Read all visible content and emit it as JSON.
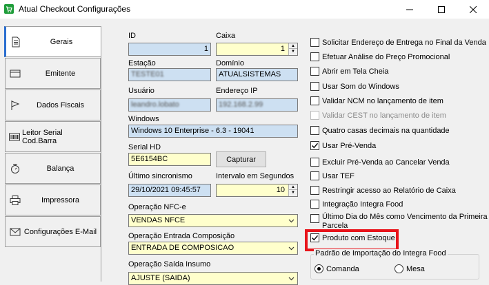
{
  "window": {
    "title": "Atual Checkout Configurações"
  },
  "tabs": [
    {
      "label": "Gerais",
      "icon": "document-icon"
    },
    {
      "label": "Emitente",
      "icon": "card-icon"
    },
    {
      "label": "Dados Fiscais",
      "icon": "flag-icon"
    },
    {
      "label": "Leitor Serial Cod.Barra",
      "icon": "barcode-icon"
    },
    {
      "label": "Balança",
      "icon": "scale-icon"
    },
    {
      "label": "Impressora",
      "icon": "printer-icon"
    },
    {
      "label": "Configurações E-Mail",
      "icon": "email-icon"
    }
  ],
  "form": {
    "id_label": "ID",
    "id_value": "1",
    "caixa_label": "Caixa",
    "caixa_value": "1",
    "estacao_label": "Estação",
    "estacao_value": "TESTE01",
    "dominio_label": "Domínio",
    "dominio_value": "ATUALSISTEMAS",
    "usuario_label": "Usuário",
    "usuario_value": "leandro.lobato",
    "endereco_ip_label": "Endereço IP",
    "endereco_ip_value": "192.168.2.99",
    "windows_label": "Windows",
    "windows_value": "Windows 10 Enterprise - 6.3 - 19041",
    "serial_hd_label": "Serial HD",
    "serial_hd_value": "5E6154BC",
    "capturar_label": "Capturar",
    "ultimo_sinc_label": "Último sincronismo",
    "ultimo_sinc_value": "29/10/2021 09:45:57",
    "intervalo_label": "Intervalo em Segundos",
    "intervalo_value": "10",
    "op_nfce_label": "Operação NFC-e",
    "op_nfce_value": "VENDAS NFCE",
    "op_entrada_label": "Operação Entrada Composição",
    "op_entrada_value": "ENTRADA DE COMPOSICAO",
    "op_saida_label": "Operação Saída Insumo",
    "op_saida_value": "AJUSTE (SAIDA)"
  },
  "options": [
    {
      "label": "Solicitar Endereço de Entrega no Final da Venda",
      "checked": false,
      "enabled": true
    },
    {
      "label": "Efetuar Análise do Preço Promocional",
      "checked": false,
      "enabled": true
    },
    {
      "label": "Abrir em Tela Cheia",
      "checked": false,
      "enabled": true
    },
    {
      "label": "Usar Som do Windows",
      "checked": false,
      "enabled": true
    },
    {
      "label": "Validar NCM no lançamento de item",
      "checked": false,
      "enabled": true
    },
    {
      "label": "Validar CEST no lançamento de item",
      "checked": false,
      "enabled": false
    },
    {
      "label": "Quatro casas decimais na quantidade",
      "checked": false,
      "enabled": true
    },
    {
      "label": "Usar Pré-Venda",
      "checked": true,
      "enabled": true
    },
    {
      "label": "Excluir Pré-Venda ao Cancelar Venda",
      "checked": false,
      "enabled": true
    },
    {
      "label": "Usar TEF",
      "checked": false,
      "enabled": true
    },
    {
      "label": "Restringir acesso ao Relatório de Caixa",
      "checked": false,
      "enabled": true
    },
    {
      "label": "Integração Integra Food",
      "checked": false,
      "enabled": true
    },
    {
      "label": "Último Dia do Mês como Vencimento da Primeira Parcela",
      "checked": false,
      "enabled": true
    },
    {
      "label": "Produto com Estoque",
      "checked": true,
      "enabled": true
    }
  ],
  "integra_food": {
    "title": "Padrão de Importação do Integra Food",
    "option_comanda": "Comanda",
    "option_mesa": "Mesa",
    "selected": "Comanda"
  },
  "colors": {
    "field_blue": "#cde0f2",
    "field_yellow": "#ffffcc",
    "highlight": "#e8131a",
    "tab_accent": "#2b6fd0"
  }
}
